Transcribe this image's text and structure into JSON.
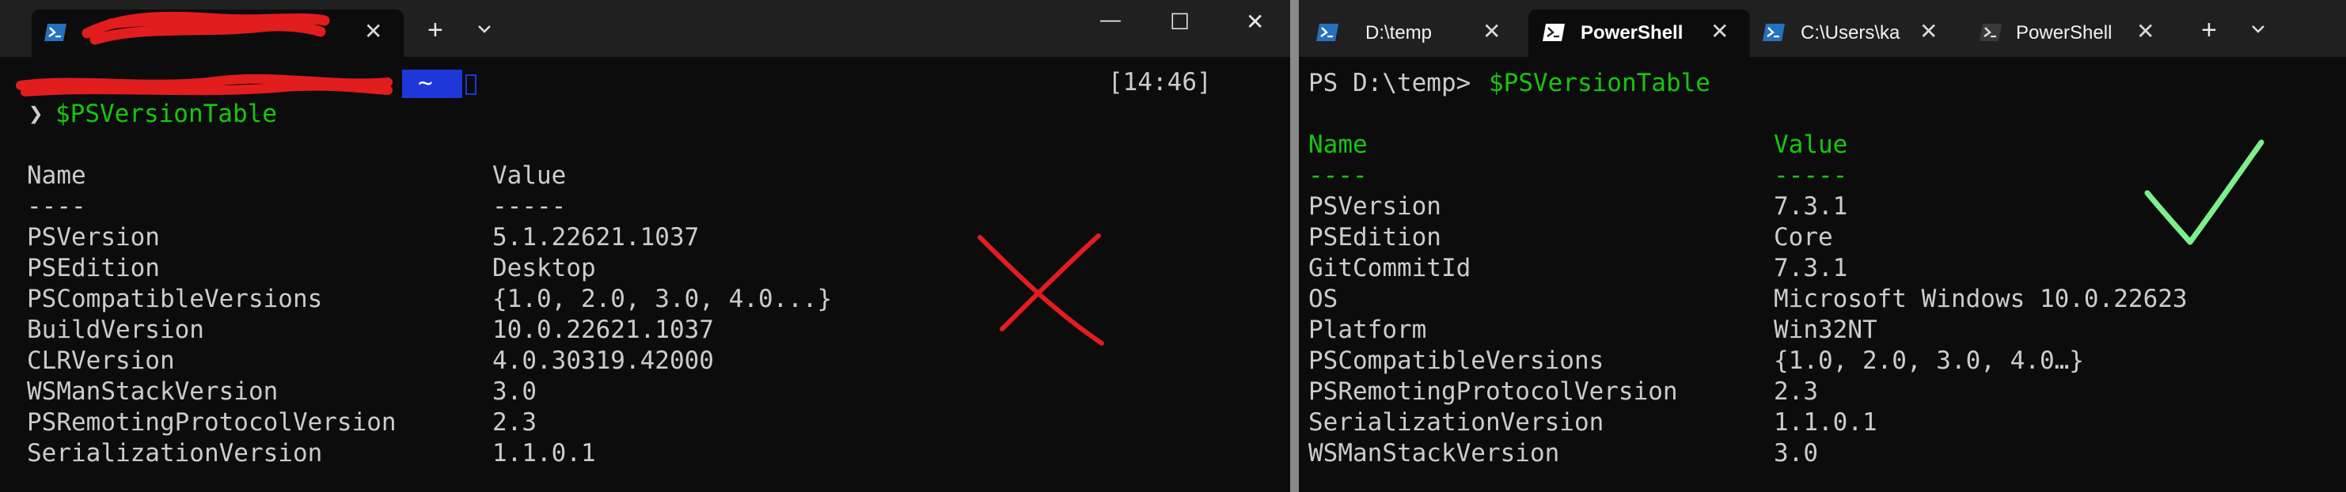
{
  "left_window": {
    "tabs": [
      {
        "label": "",
        "icon": "powershell-icon",
        "active": true
      }
    ],
    "new_tab_label": "+",
    "dropdown_icon": "chevron-down-icon",
    "window_controls": {
      "minimize": "—",
      "maximize": "☐",
      "close": "✕"
    },
    "prompt": {
      "path_badge": "~",
      "time": "[14:46]",
      "arrow": "❯",
      "command": "$PSVersionTable"
    },
    "table": {
      "header_name": "Name",
      "header_value": "Value",
      "underline_name": "----",
      "underline_value": "-----",
      "rows": [
        {
          "name": "PSVersion",
          "value": "5.1.22621.1037"
        },
        {
          "name": "PSEdition",
          "value": "Desktop"
        },
        {
          "name": "PSCompatibleVersions",
          "value": "{1.0, 2.0, 3.0, 4.0...}"
        },
        {
          "name": "BuildVersion",
          "value": "10.0.22621.1037"
        },
        {
          "name": "CLRVersion",
          "value": "4.0.30319.42000"
        },
        {
          "name": "WSManStackVersion",
          "value": "3.0"
        },
        {
          "name": "PSRemotingProtocolVersion",
          "value": "2.3"
        },
        {
          "name": "SerializationVersion",
          "value": "1.1.0.1"
        }
      ]
    },
    "annotation": {
      "type": "cross",
      "color": "#e11d1d"
    }
  },
  "right_window": {
    "tabs": [
      {
        "label": "D:\\temp",
        "icon": "powershell-icon",
        "active": false
      },
      {
        "label": "PowerShell",
        "icon": "powershell-icon",
        "active": true
      },
      {
        "label": "C:\\Users\\ka",
        "icon": "powershell-icon",
        "active": false
      },
      {
        "label": "PowerShell",
        "icon": "powershell-icon",
        "active": false
      }
    ],
    "new_tab_label": "+",
    "dropdown_icon": "chevron-down-icon",
    "prompt": {
      "text": "PS D:\\temp> ",
      "command": "$PSVersionTable"
    },
    "table": {
      "header_name": "Name",
      "header_value": "Value",
      "underline_name": "----",
      "underline_value": "-----",
      "rows": [
        {
          "name": "PSVersion",
          "value": "7.3.1"
        },
        {
          "name": "PSEdition",
          "value": "Core"
        },
        {
          "name": "GitCommitId",
          "value": "7.3.1"
        },
        {
          "name": "OS",
          "value": "Microsoft Windows 10.0.22623"
        },
        {
          "name": "Platform",
          "value": "Win32NT"
        },
        {
          "name": "PSCompatibleVersions",
          "value": "{1.0, 2.0, 3.0, 4.0…}"
        },
        {
          "name": "PSRemotingProtocolVersion",
          "value": "2.3"
        },
        {
          "name": "SerializationVersion",
          "value": "1.1.0.1"
        },
        {
          "name": "WSManStackVersion",
          "value": "3.0"
        }
      ]
    },
    "annotation": {
      "type": "checkmark",
      "color": "#7cf08a"
    }
  },
  "colors": {
    "background": "#0c0c0c",
    "tabbar": "#202020",
    "text": "#cccccc",
    "prompt_green": "#16c60c",
    "header_green": "#13a10e",
    "path_badge": "#1d37d8",
    "redaction": "#e11d1d"
  }
}
